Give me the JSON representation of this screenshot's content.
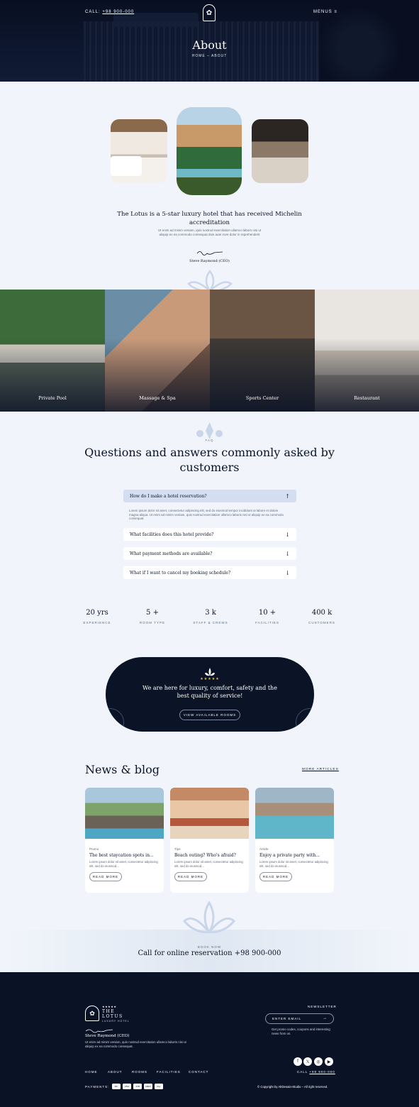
{
  "header": {
    "call_label": "CALL:",
    "phone": "+98 900-000",
    "menu_label": "MENUS",
    "title": "About",
    "breadcrumb": "HOME – ABOUT"
  },
  "about": {
    "heading": "The Lotus is a 5-star luxury hotel that has received Michelin accreditation",
    "text": "Ut enim ad minim veniam, quis nostrud exercitation ullamco labors nisi ut aliquip ex ea commodo consequat duis aute irure dolor in reprehenderit",
    "signer": "Steve Raymond (CEO)"
  },
  "services": [
    {
      "label": "Private Pool"
    },
    {
      "label": "Massage & Spa"
    },
    {
      "label": "Sports Center"
    },
    {
      "label": "Restaurant"
    }
  ],
  "faq": {
    "tag": "FAQ",
    "title": "Questions and answers commonly asked by customers",
    "items": [
      {
        "question": "How do I make a hotel reservation?",
        "answer": "Lorem ipsum dolor sit amet, consectetur adipiscing elit, sed do eiusmod tempor incididunt ut labore et dolore magna aliqua. Ut enim ad minim veniam, quis nostrud exercitation ullamco laboris nisi ut aliquip ex ea commodo consequat."
      },
      {
        "question": "What facilities does this hotel provide?"
      },
      {
        "question": "What payment methods are available?"
      },
      {
        "question": "What if I want to cancel my booking schedule?"
      }
    ]
  },
  "stats": [
    {
      "value": "20 yrs",
      "label": "EXPERIENCE"
    },
    {
      "value": "5 +",
      "label": "ROOM TYPE"
    },
    {
      "value": "3 k",
      "label": "STAFF & CREWS"
    },
    {
      "value": "10 +",
      "label": "FACILITIES"
    },
    {
      "value": "400 k",
      "label": "CUSTOMERS"
    }
  ],
  "cta": {
    "stars": "★★★★★",
    "text": "We are here for luxury, comfort, safety and the best quality of service!",
    "button": "VIEW AVAILABLE ROOMS"
  },
  "news": {
    "title": "News & blog",
    "more": "MORE ARTICLES",
    "read_more": "READ MORE",
    "cards": [
      {
        "category": "Promo",
        "title": "The best staycation spots in...",
        "excerpt": "Lorem ipsum dolor sit amet, consectetur adipiscing elit, sed do eiusmod..."
      },
      {
        "category": "Tips",
        "title": "Beach outing? Who's afraid?",
        "excerpt": "Lorem ipsum dolor sit amet, consectetur adipiscing elit, sed do eiusmod..."
      },
      {
        "category": "Article",
        "title": "Enjoy a private party with...",
        "excerpt": "Lorem ipsum dolor sit amet, consectetur adipiscing elit, sed do eiusmod..."
      }
    ]
  },
  "book": {
    "tag": "BOOK NOW",
    "call": "Call for online reservation +98 900-000"
  },
  "footer": {
    "stars": "★★★★★",
    "brand_line1": "THE",
    "brand_line2": "LOTUS",
    "brand_sub": "LUXURY HOTEL",
    "name": "Steve Raymond (CEO)",
    "desc": "Ut enim ad minim veniam, quis nostrud exercitation ullamco laboris nisi ut aliquip ex ea commodo consequat.",
    "newsletter": "NEWSLETTER",
    "email_placeholder": "ENTER EMAIL",
    "promo": "Get promo codes, coupons and interesting news from us.",
    "call_label": "CALL",
    "phone": "+98 900-000",
    "nav": [
      "HOME",
      "ABOUT",
      "ROOMS",
      "FACILITIES",
      "CONTACT"
    ],
    "payments_label": "PAYMENTS:",
    "payment_methods": [
      "MC",
      "VISA",
      "JCB",
      "AMEX",
      "Pay"
    ],
    "copyright": "© Copyright by AltDesain-Studio – All right reserved."
  },
  "colors": {
    "navy": "#0b1426",
    "accent_gold": "#e8c34a",
    "bg": "#f1f5fb"
  }
}
